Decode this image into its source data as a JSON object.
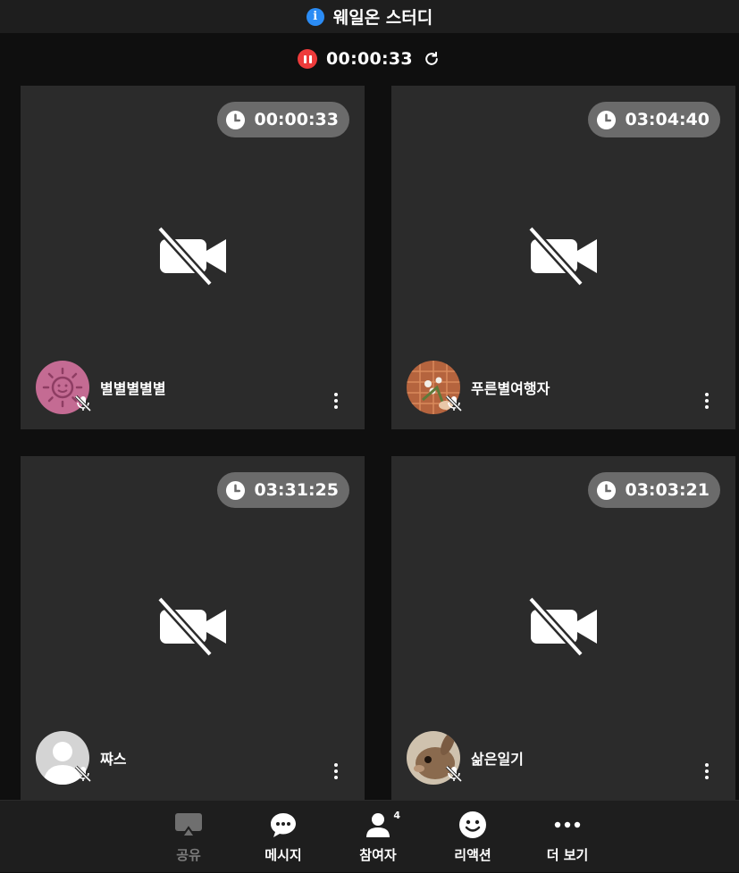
{
  "header": {
    "title": "웨일온 스터디",
    "info_icon": "info-icon"
  },
  "recording": {
    "time": "00:00:33",
    "status_icon": "pause-icon",
    "refresh_icon": "refresh-icon",
    "status_color": "#ee3b3b"
  },
  "tiles": [
    {
      "timer": "00:00:33",
      "name": "별별별별별",
      "avatar": "sun-avatar",
      "camera": "off",
      "mic": "muted"
    },
    {
      "timer": "03:04:40",
      "name": "푸른별여행자",
      "avatar": "photo-avatar",
      "camera": "off",
      "mic": "muted"
    },
    {
      "timer": "03:31:25",
      "name": "쨔스",
      "avatar": "default-avatar",
      "camera": "off",
      "mic": "muted"
    },
    {
      "timer": "03:03:21",
      "name": "삶은일기",
      "avatar": "rabbit-avatar",
      "camera": "off",
      "mic": "muted"
    }
  ],
  "toolbar": {
    "share": {
      "label": "공유",
      "icon": "share-screen-icon",
      "disabled": true
    },
    "message": {
      "label": "메시지",
      "icon": "chat-icon"
    },
    "participants": {
      "label": "참여자",
      "icon": "person-icon",
      "count": "4"
    },
    "reaction": {
      "label": "리액션",
      "icon": "smiley-icon"
    },
    "more": {
      "label": "더 보기",
      "icon": "more-horizontal-icon"
    }
  },
  "colors": {
    "tile_bg": "#2b2b2b",
    "page_bg": "#0f0f0f",
    "timer_pill": "#6b6b6b",
    "info_blue": "#2b8cf5"
  }
}
